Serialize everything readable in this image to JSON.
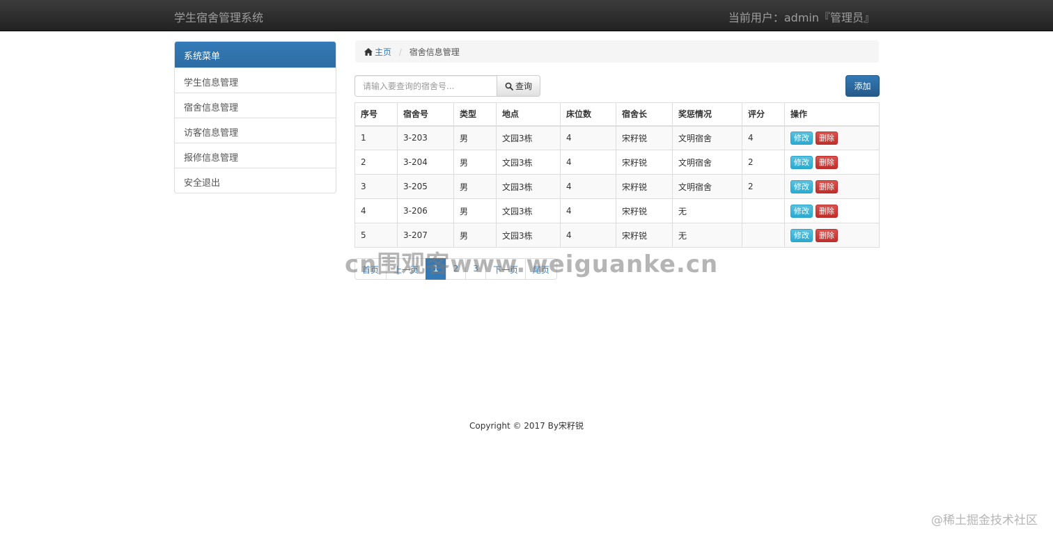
{
  "navbar": {
    "brand": "学生宿舍管理系统",
    "current_user": "当前用户：admin『管理员』"
  },
  "sidebar": {
    "header": "系统菜单",
    "items": [
      {
        "label": "学生信息管理"
      },
      {
        "label": "宿舍信息管理"
      },
      {
        "label": "访客信息管理"
      },
      {
        "label": "报修信息管理"
      },
      {
        "label": "安全退出"
      }
    ]
  },
  "breadcrumb": {
    "home": "主页",
    "separator": "/",
    "current": "宿舍信息管理"
  },
  "search": {
    "placeholder": "请输入要查询的宿舍号...",
    "button_label": "查询"
  },
  "add_button": "添加",
  "table": {
    "headers": [
      "序号",
      "宿舍号",
      "类型",
      "地点",
      "床位数",
      "宿舍长",
      "奖惩情况",
      "评分",
      "操作"
    ],
    "rows": [
      {
        "no": "1",
        "room": "3-203",
        "type": "男",
        "location": "文园3栋",
        "beds": "4",
        "leader": "宋籽锐",
        "reward": "文明宿舍",
        "score": "4",
        "edit": "修改",
        "delete": "删除"
      },
      {
        "no": "2",
        "room": "3-204",
        "type": "男",
        "location": "文园3栋",
        "beds": "4",
        "leader": "宋籽锐",
        "reward": "文明宿舍",
        "score": "2",
        "edit": "修改",
        "delete": "删除"
      },
      {
        "no": "3",
        "room": "3-205",
        "type": "男",
        "location": "文园3栋",
        "beds": "4",
        "leader": "宋籽锐",
        "reward": "文明宿舍",
        "score": "2",
        "edit": "修改",
        "delete": "删除"
      },
      {
        "no": "4",
        "room": "3-206",
        "type": "男",
        "location": "文园3栋",
        "beds": "4",
        "leader": "宋籽锐",
        "reward": "无",
        "score": "",
        "edit": "修改",
        "delete": "删除"
      },
      {
        "no": "5",
        "room": "3-207",
        "type": "男",
        "location": "文园3栋",
        "beds": "4",
        "leader": "宋籽锐",
        "reward": "无",
        "score": "",
        "edit": "修改",
        "delete": "删除"
      }
    ]
  },
  "pagination": {
    "first": "首页",
    "prev": "上一页",
    "pages": [
      "1",
      "2",
      "3"
    ],
    "active_page": "1",
    "next": "下一页",
    "last": "尾页"
  },
  "footer": "Copyright © 2017 By宋籽锐",
  "watermarks": {
    "center": "cn围观客www.weiguanke.cn",
    "corner": "@稀土掘金技术社区"
  },
  "colors": {
    "primary": "#337ab7",
    "info": "#5bc0de",
    "danger": "#d9534f",
    "navbar": "#222222"
  }
}
